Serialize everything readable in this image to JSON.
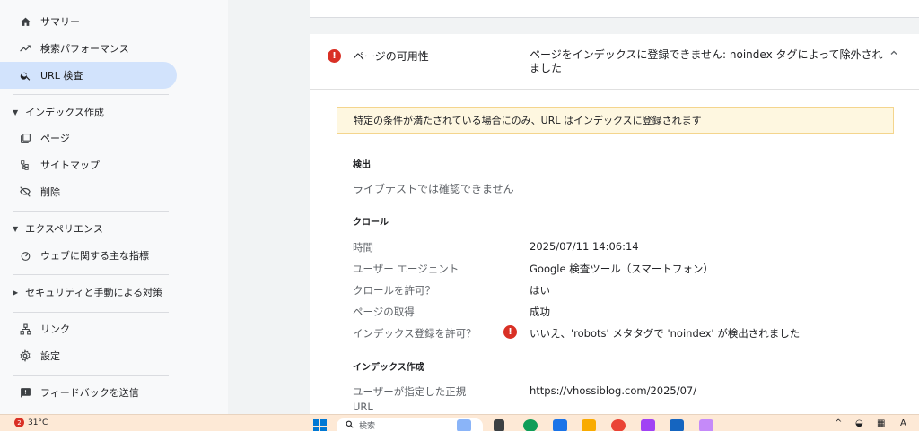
{
  "sidebar": {
    "items": [
      {
        "label": "サマリー",
        "icon": "home-icon"
      },
      {
        "label": "検索パフォーマンス",
        "icon": "trending-up-icon"
      },
      {
        "label": "URL 検査",
        "icon": "search-icon"
      }
    ],
    "sections": [
      {
        "title": "インデックス作成",
        "items": [
          {
            "label": "ページ",
            "icon": "pages-icon"
          },
          {
            "label": "サイトマップ",
            "icon": "sitemap-icon"
          },
          {
            "label": "削除",
            "icon": "visibility-off-icon"
          }
        ]
      },
      {
        "title": "エクスペリエンス",
        "items": [
          {
            "label": "ウェブに関する主な指標",
            "icon": "speed-icon"
          }
        ]
      },
      {
        "title": "セキュリティと手動による対策",
        "items": []
      }
    ],
    "bottom": [
      {
        "label": "リンク",
        "icon": "links-icon"
      },
      {
        "label": "設定",
        "icon": "gear-icon"
      },
      {
        "label": "フィードバックを送信",
        "icon": "feedback-icon"
      }
    ]
  },
  "card": {
    "title": "ページの可用性",
    "status": "ページをインデックスに登録できません: noindex タグによって除外されました",
    "notice_link": "特定の条件",
    "notice_rest": "が満たされている場合にのみ、URL はインデックスに登録されます",
    "detect": {
      "heading": "検出",
      "text": "ライブテストでは確認できません"
    },
    "crawl": {
      "heading": "クロール",
      "rows": [
        {
          "label": "時間",
          "value": "2025/07/11 14:06:14"
        },
        {
          "label": "ユーザー エージェント",
          "value": "Google 検査ツール（スマートフォン）"
        },
        {
          "label": "クロールを許可？",
          "value": "はい"
        },
        {
          "label": "ページの取得",
          "value": "成功"
        },
        {
          "label": "インデックス登録を許可？",
          "value": "いいえ、'robots' メタタグで 'noindex' が検出されました"
        }
      ]
    },
    "indexing": {
      "heading": "インデックス作成",
      "canonical_label_line1": "ユーザーが指定した正規",
      "canonical_label_line2": "URL",
      "canonical_value": "https://vhossiblog.com/2025/07/"
    }
  },
  "taskbar": {
    "weather_badge": "2",
    "temperature": "31°C",
    "search_placeholder": "検索",
    "tray_icons": [
      "chevron-up-icon",
      "network-icon",
      "keyboard-icon"
    ],
    "ime": "A"
  }
}
